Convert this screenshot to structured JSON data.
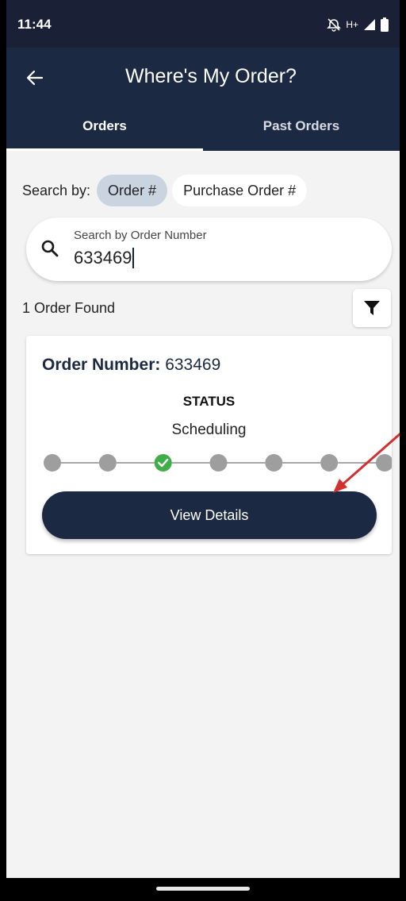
{
  "status_bar": {
    "time": "11:44",
    "network": "H+"
  },
  "app_bar": {
    "title": "Where's My Order?"
  },
  "tabs": [
    {
      "label": "Orders",
      "active": true
    },
    {
      "label": "Past Orders",
      "active": false
    }
  ],
  "search_by": {
    "label": "Search by:",
    "options": [
      {
        "label": "Order #",
        "selected": true
      },
      {
        "label": "Purchase Order #",
        "selected": false
      }
    ]
  },
  "search": {
    "label": "Search by Order Number",
    "value": "633469"
  },
  "results": {
    "count_text": "1 Order Found"
  },
  "order": {
    "number_label": "Order Number:",
    "number": "633469",
    "status_heading": "STATUS",
    "status_value": "Scheduling",
    "progress_steps": 7,
    "current_step": 3,
    "button_label": "View Details"
  },
  "colors": {
    "primary": "#1c2942",
    "status_bar": "#1a2036",
    "background": "#f3f3f3",
    "chip_selected": "#c9d4e0",
    "step_done": "#3fae49",
    "step_pending": "#9e9e9e",
    "annotation": "#d32f2f"
  }
}
